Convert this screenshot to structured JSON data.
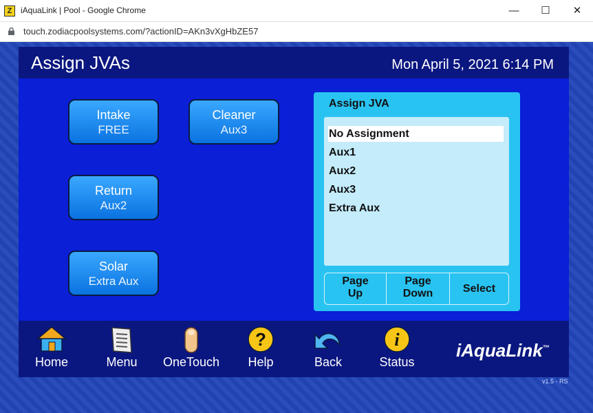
{
  "window": {
    "title": "iAquaLink | Pool - Google Chrome",
    "app_icon_glyph": "Z",
    "min_glyph": "—",
    "max_glyph": "☐",
    "close_glyph": "✕"
  },
  "address": {
    "url": "touch.zodiacpoolsystems.com/?actionID=AKn3vXgHbZE57"
  },
  "header": {
    "title": "Assign JVAs",
    "datetime": "Mon April 5, 2021 6:14 PM"
  },
  "jva_buttons": [
    {
      "name": "Intake",
      "value": "FREE"
    },
    {
      "name": "Cleaner",
      "value": "Aux3"
    },
    {
      "name": "Return",
      "value": "Aux2"
    },
    {
      "name": "Solar",
      "value": "Extra Aux"
    }
  ],
  "assign": {
    "title": "Assign JVA",
    "options": [
      "No Assignment",
      "Aux1",
      "Aux2",
      "Aux3",
      "Extra Aux"
    ],
    "selected": "No Assignment",
    "page_up_line1": "Page",
    "page_up_line2": "Up",
    "page_down_line1": "Page",
    "page_down_line2": "Down",
    "select_label": "Select"
  },
  "nav": {
    "home": "Home",
    "menu": "Menu",
    "onetouch": "OneTouch",
    "help": "Help",
    "back": "Back",
    "status": "Status"
  },
  "brand": "iAquaLink",
  "brand_tm": "™",
  "version": "v1.5 - RS",
  "colors": {
    "panel_bg": "#0a1fd6",
    "header_bg": "#0b1780",
    "button_gradient_top": "#3aa8ff",
    "button_gradient_bottom": "#0a72e0",
    "assign_bg": "#29c3f2",
    "list_bg": "#c4ecfb"
  }
}
